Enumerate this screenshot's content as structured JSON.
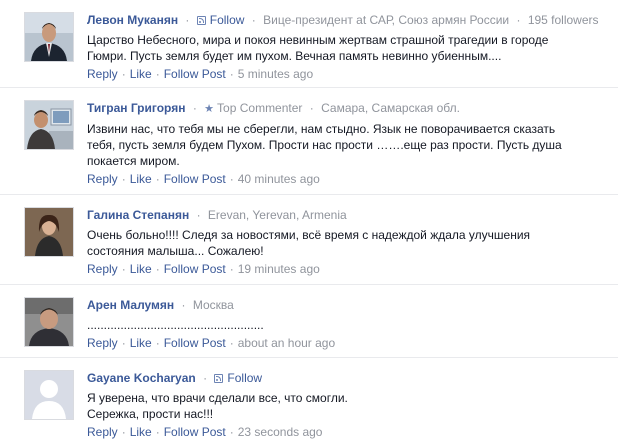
{
  "actions": {
    "reply": "Reply",
    "like": "Like",
    "follow_post": "Follow Post",
    "separator": "·"
  },
  "comments": [
    {
      "author": "Левон Муканян",
      "follow": "Follow",
      "detail": "Вице-президент at САР, Союз армян России",
      "followers": "195 followers",
      "lines": [
        "Царство Небесного, мира и покоя невинным жертвам страшной трагедии в городе",
        "Гюмри. Пусть земля будет им пухом. Вечная память невинно убиенным...."
      ],
      "time": "5 minutes ago",
      "avatar": "man-in-suit"
    },
    {
      "author": "Тигран Григорян",
      "badge": "Top Commenter",
      "detail": "Самара, Самарская обл.",
      "lines": [
        "Извини нас, что тебя мы не сберегли, нам стыдно. Язык не поворачивается сказать",
        "тебя, пусть земля будем Пухом. Прости нас прости …….еще раз прости. Пусть душа",
        "покается миром."
      ],
      "time": "40 minutes ago",
      "avatar": "man-at-computer"
    },
    {
      "author": "Галина Степанян",
      "detail": "Erevan, Yerevan, Armenia",
      "lines": [
        "Очень больно!!!! Следя за новостями, всё время с надеждой ждала улучшения",
        "состояния малыша... Сожалею!"
      ],
      "time": "19 minutes ago",
      "avatar": "woman-portrait"
    },
    {
      "author": "Арен Малумян",
      "detail": "Москва",
      "lines": [
        "....................................................."
      ],
      "time": "about an hour ago",
      "avatar": "man-portrait"
    },
    {
      "author": "Gayane Kocharyan",
      "follow": "Follow",
      "lines": [
        "Я уверена, что врачи сделали все, что смогли.",
        "Сережка, прости нас!!!"
      ],
      "time": "23 seconds ago",
      "avatar": "default-silhouette"
    }
  ],
  "colors": {
    "link": "#3b5998",
    "meta": "#90949c",
    "text": "#141823"
  }
}
